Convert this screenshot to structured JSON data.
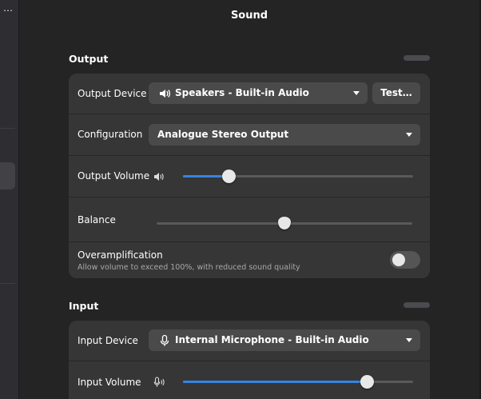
{
  "window": {
    "title": "Sound"
  },
  "sidebar": {
    "menu_glyph": "⋯"
  },
  "output": {
    "heading": "Output",
    "device": {
      "label": "Output Device",
      "value": "Speakers - Built-in Audio",
      "icon": "speaker-icon",
      "test_label": "Test…"
    },
    "configuration": {
      "label": "Configuration",
      "value": "Analogue Stereo Output"
    },
    "volume": {
      "label": "Output Volume",
      "icon": "speaker-volume-icon",
      "level": 0.2
    },
    "balance": {
      "label": "Balance",
      "level": 0.5
    },
    "overamplification": {
      "label": "Overamplification",
      "description": "Allow volume to exceed 100%, with reduced sound quality",
      "enabled": false
    }
  },
  "input": {
    "heading": "Input",
    "device": {
      "label": "Input Device",
      "value": "Internal Microphone - Built-in Audio",
      "icon": "microphone-icon"
    },
    "volume": {
      "label": "Input Volume",
      "icon": "microphone-volume-icon",
      "level": 0.8
    }
  },
  "colors": {
    "accent": "#3584e4",
    "card": "#363636",
    "background": "#242424"
  }
}
